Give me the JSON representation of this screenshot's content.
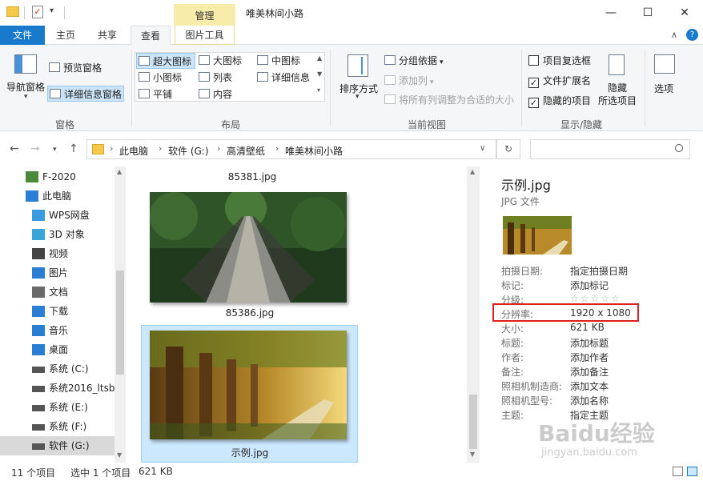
{
  "titlebar": {
    "manage_tab": "管理",
    "title": "唯美林间小路",
    "minimize": "—",
    "maximize": "☐",
    "close": "✕"
  },
  "tabs": {
    "file": "文件",
    "home": "主页",
    "share": "共享",
    "view": "查看",
    "picture_tools": "图片工具"
  },
  "ribbon": {
    "pane": {
      "nav_pane": "导航窗格",
      "preview_pane": "预览窗格",
      "details_pane": "详细信息窗格",
      "label": "窗格"
    },
    "layout": {
      "items": [
        "超大图标",
        "大图标",
        "中图标",
        "小图标",
        "列表",
        "详细信息",
        "平铺",
        "内容"
      ],
      "label": "布局"
    },
    "current_view": {
      "sort_by": "排序方式",
      "group_by": "分组依据",
      "add_column": "添加列",
      "size_all_columns": "将所有列调整为合适的大小",
      "label": "当前视图"
    },
    "show_hide": {
      "item_checkboxes": "项目复选框",
      "file_extensions": "文件扩展名",
      "hidden_items": "隐藏的项目",
      "item_checkboxes_checked": false,
      "file_extensions_checked": true,
      "hidden_items_checked": true,
      "hide_selected_line1": "隐藏",
      "hide_selected_line2": "所选项目",
      "label": "显示/隐藏"
    },
    "options": "选项"
  },
  "address": {
    "crumbs": [
      "此电脑",
      "软件 (G:)",
      "高清壁纸",
      "唯美林间小路"
    ]
  },
  "nav": {
    "items": [
      {
        "label": "F-2020",
        "icon": "user-icon"
      },
      {
        "label": "此电脑",
        "icon": "computer-icon"
      },
      {
        "label": "WPS网盘",
        "icon": "cloud-icon"
      },
      {
        "label": "3D 对象",
        "icon": "cube-icon"
      },
      {
        "label": "视频",
        "icon": "video-icon"
      },
      {
        "label": "图片",
        "icon": "picture-icon"
      },
      {
        "label": "文档",
        "icon": "document-icon"
      },
      {
        "label": "下载",
        "icon": "download-icon"
      },
      {
        "label": "音乐",
        "icon": "music-icon"
      },
      {
        "label": "桌面",
        "icon": "desktop-icon"
      },
      {
        "label": "系统 (C:)",
        "icon": "drive-icon"
      },
      {
        "label": "系统2016_ltsb",
        "icon": "drive-icon"
      },
      {
        "label": "系统 (E:)",
        "icon": "drive-icon"
      },
      {
        "label": "系统 (F:)",
        "icon": "drive-icon"
      },
      {
        "label": "软件 (G:)",
        "icon": "drive-icon"
      }
    ]
  },
  "files": {
    "top_name": "85381.jpg",
    "items": [
      {
        "name": "85386.jpg"
      },
      {
        "name": "示例.jpg"
      }
    ]
  },
  "details": {
    "filename": "示例.jpg",
    "filetype": "JPG 文件",
    "rows": [
      {
        "label": "拍摄日期:",
        "value": "指定拍摄日期"
      },
      {
        "label": "标记:",
        "value": "添加标记"
      },
      {
        "label": "分级:",
        "value": "☆☆☆☆☆"
      },
      {
        "label": "分辨率:",
        "value": "1920 x 1080"
      },
      {
        "label": "大小:",
        "value": "621 KB"
      },
      {
        "label": "标题:",
        "value": "添加标题"
      },
      {
        "label": "作者:",
        "value": "添加作者"
      },
      {
        "label": "备注:",
        "value": "添加备注"
      },
      {
        "label": "照相机制造商:",
        "value": "添加文本"
      },
      {
        "label": "照相机型号:",
        "value": "添加名称"
      },
      {
        "label": "主题:",
        "value": "指定主题"
      }
    ]
  },
  "status": {
    "count": "11 个项目",
    "selected": "选中 1 个项目",
    "size": "621 KB"
  },
  "watermark": {
    "brand": "Baidu经验",
    "url": "jingyan.baidu.com"
  },
  "colors": {
    "accent": "#1979ca",
    "manage_tab": "#f7ecaa",
    "selection": "#cce8ff",
    "highlight_box": "#e02020"
  }
}
